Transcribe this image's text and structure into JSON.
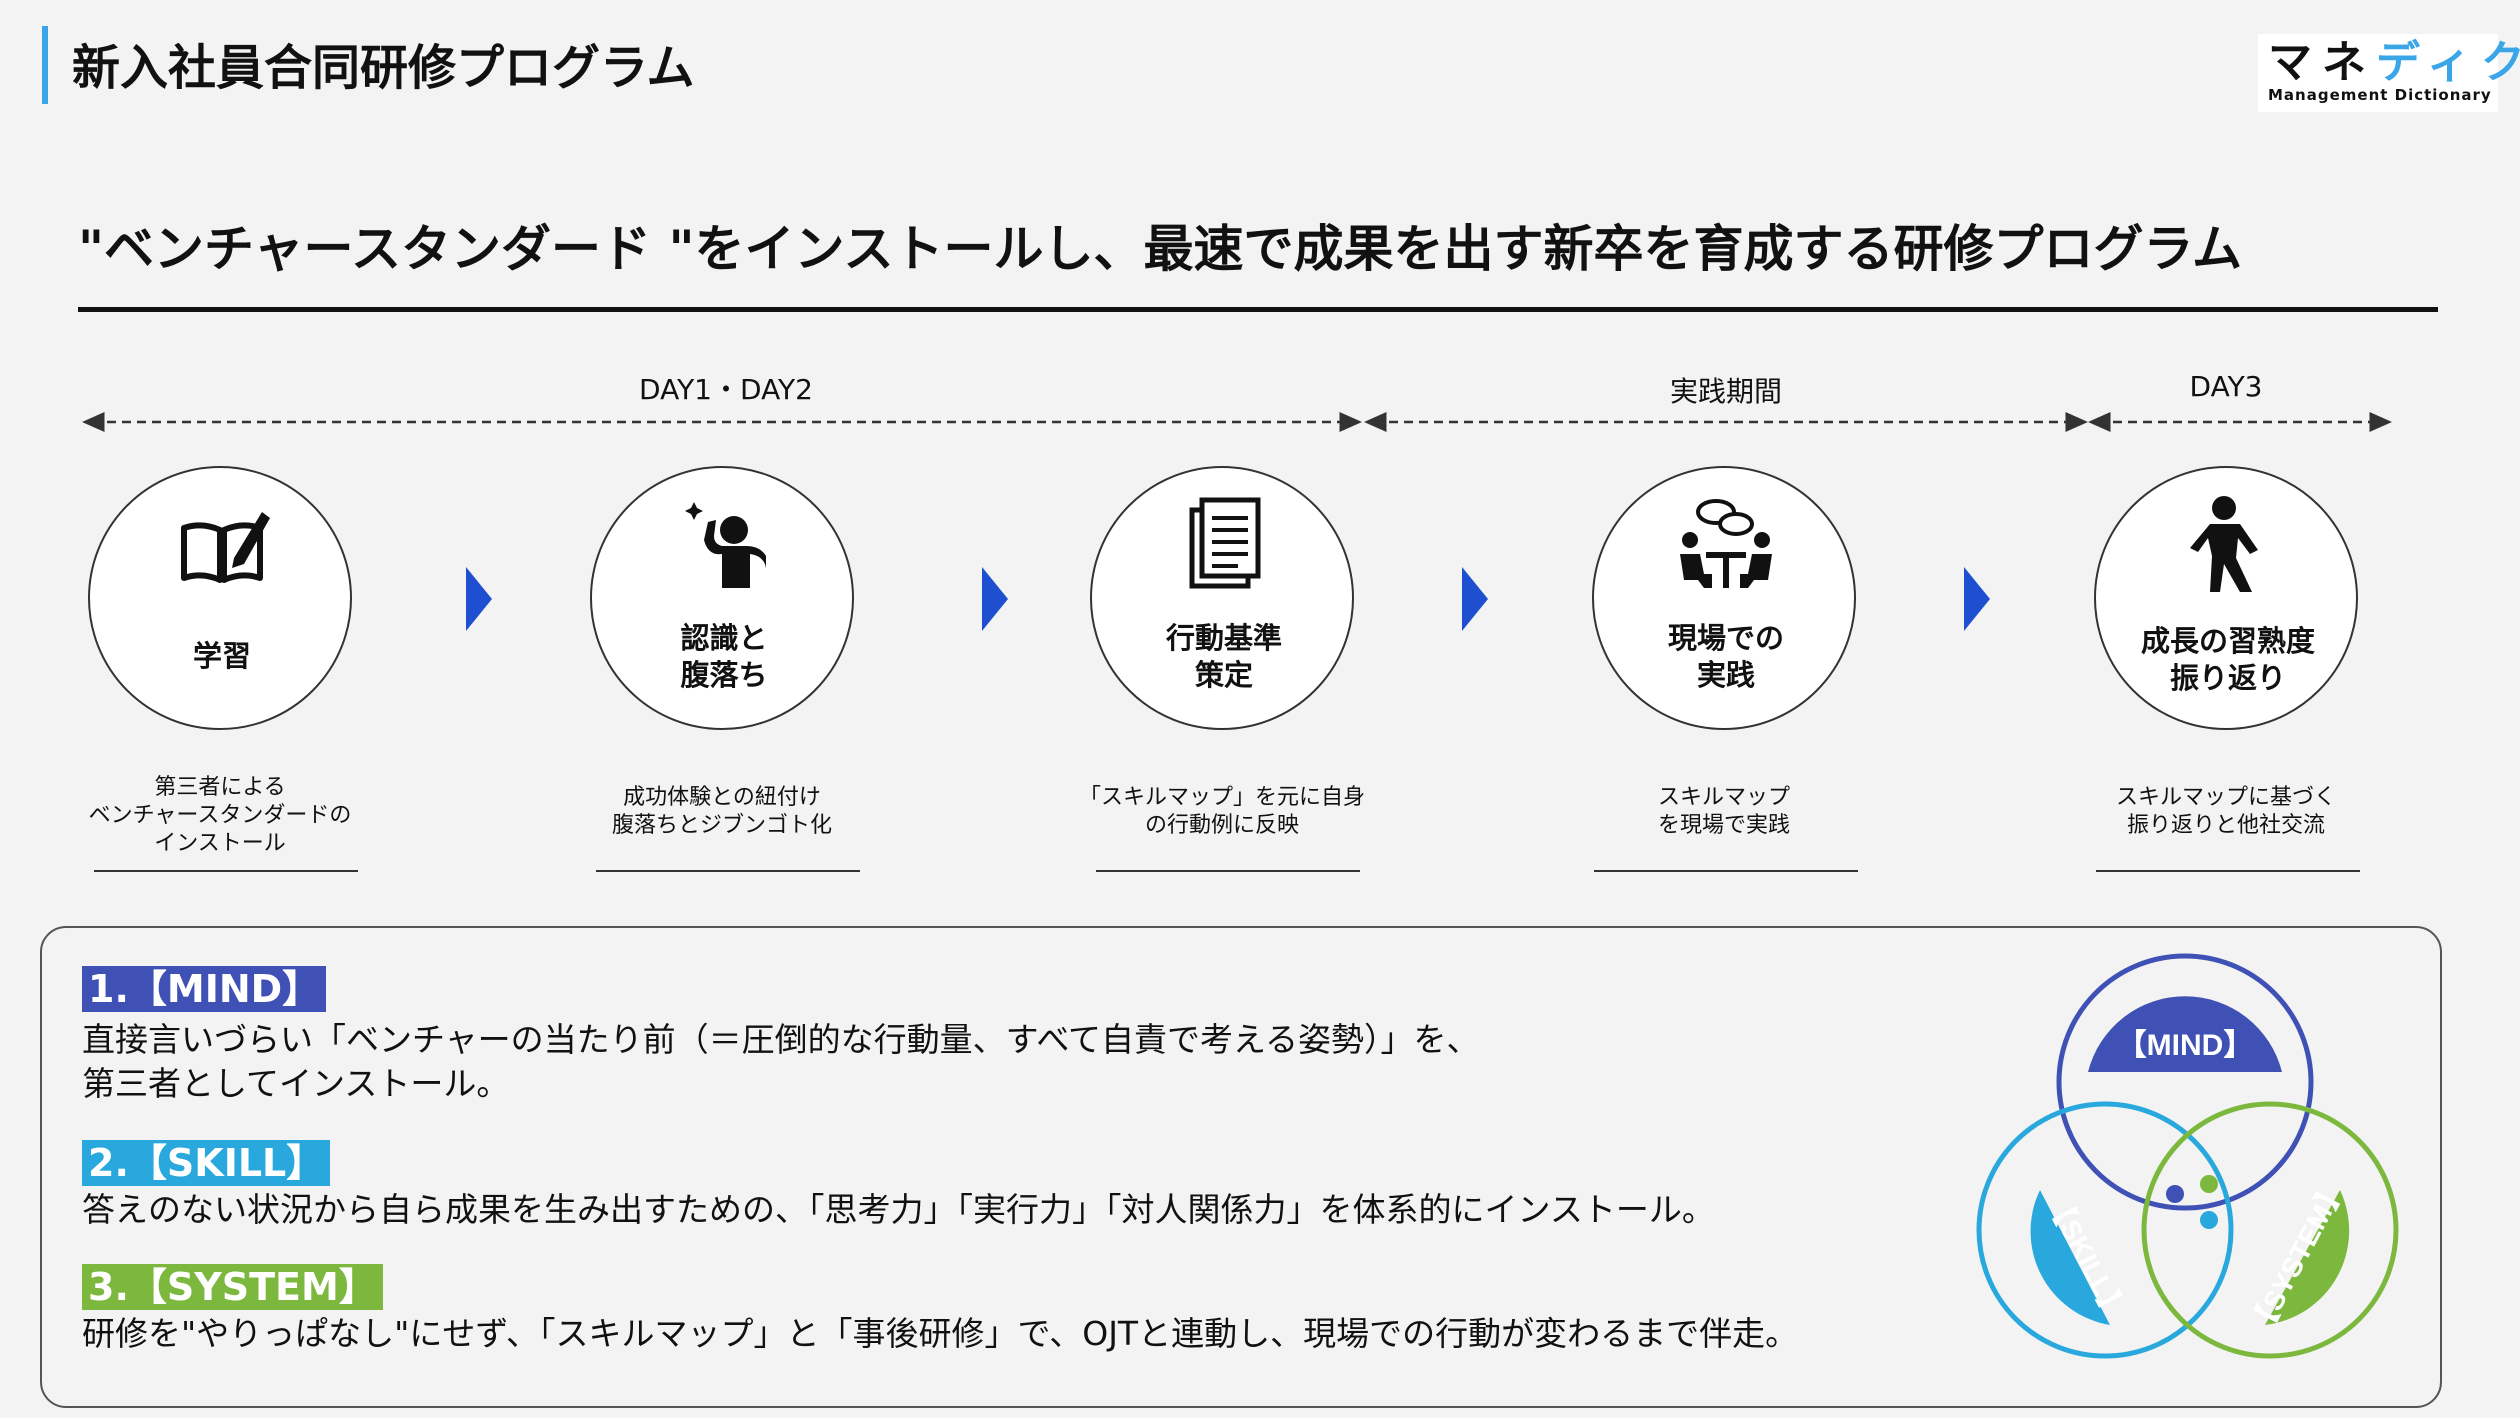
{
  "header": {
    "title": "新入社員合同研修プログラム",
    "logo_main_a": "マネ",
    "logo_main_b": "ディク",
    "logo_sub": "Management Dictionary"
  },
  "headline": "\"ベンチャースタンダード \"をインストールし、最速で成果を出す新卒を育成する研修プログラム",
  "phases": [
    {
      "label": "DAY1・DAY2"
    },
    {
      "label": "実践期間"
    },
    {
      "label": "DAY3"
    }
  ],
  "steps": [
    {
      "icon": "book-pen-icon",
      "label_lines": [
        "学習"
      ],
      "desc_lines": [
        "第三者による",
        "ベンチャースタンダードの",
        "インストール"
      ]
    },
    {
      "icon": "person-realization-icon",
      "label_lines": [
        "認識と",
        "腹落ち"
      ],
      "desc_lines": [
        "成功体験との紐付け",
        "腹落ちとジブンゴト化"
      ]
    },
    {
      "icon": "document-list-icon",
      "label_lines": [
        "行動基準",
        "策定"
      ],
      "desc_lines": [
        "「スキルマップ」を元に自身",
        "の行動例に反映"
      ]
    },
    {
      "icon": "meeting-icon",
      "label_lines": [
        "現場での",
        "実践"
      ],
      "desc_lines": [
        "スキルマップ",
        "を現場で実践"
      ]
    },
    {
      "icon": "running-person-icon",
      "label_lines": [
        "成長の習熟度",
        "振り返り"
      ],
      "desc_lines": [
        "スキルマップに基づく",
        "振り返りと他社交流"
      ]
    }
  ],
  "pillars": [
    {
      "tag": "1.【MIND】",
      "color": "#3f51b5",
      "lines": [
        "直接言いづらい「ベンチャーの当たり前（＝圧倒的な行動量、すべて自責で考える姿勢）」を、",
        "第三者としてインストール。"
      ]
    },
    {
      "tag": "2.【SKILL】",
      "color": "#29a8dd",
      "lines": [
        "答えのない状況から自ら成果を生み出すための、「思考力」「実行力」「対人関係力」を体系的にインストール。"
      ]
    },
    {
      "tag": "3.【SYSTEM】",
      "color": "#7cb83e",
      "lines": [
        "研修を\"やりっぱなし\"にせず、「スキルマップ」と「事後研修」で、OJTと連動し、現場での行動が変わるまで伴走。"
      ]
    }
  ],
  "diagram": {
    "mind": "【MIND】",
    "skill": "【SKILL】",
    "system": "【SYSTEM】",
    "colors": {
      "mind": "#3f51b5",
      "skill": "#29a8dd",
      "system": "#7cb83e"
    }
  }
}
